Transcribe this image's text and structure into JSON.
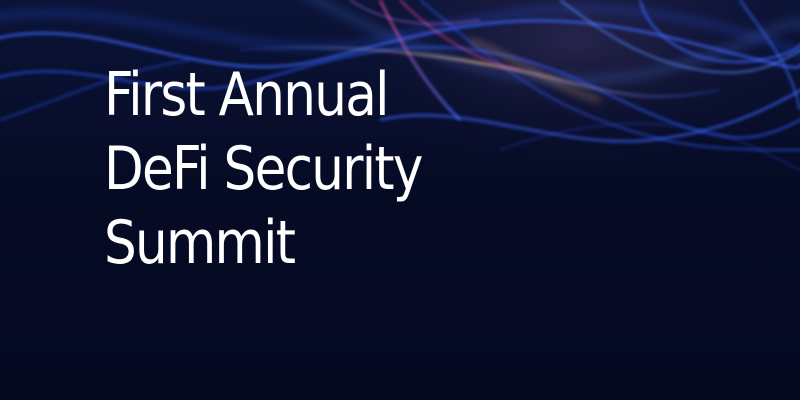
{
  "headline": {
    "lines": [
      "First Annual",
      "DeFi Security",
      "Summit"
    ]
  },
  "background": {
    "base_color": "#060b25",
    "wave_colors": [
      "#2f5bff",
      "#5a8dff",
      "#d2458a",
      "#c77dff",
      "#f0b37a"
    ]
  }
}
